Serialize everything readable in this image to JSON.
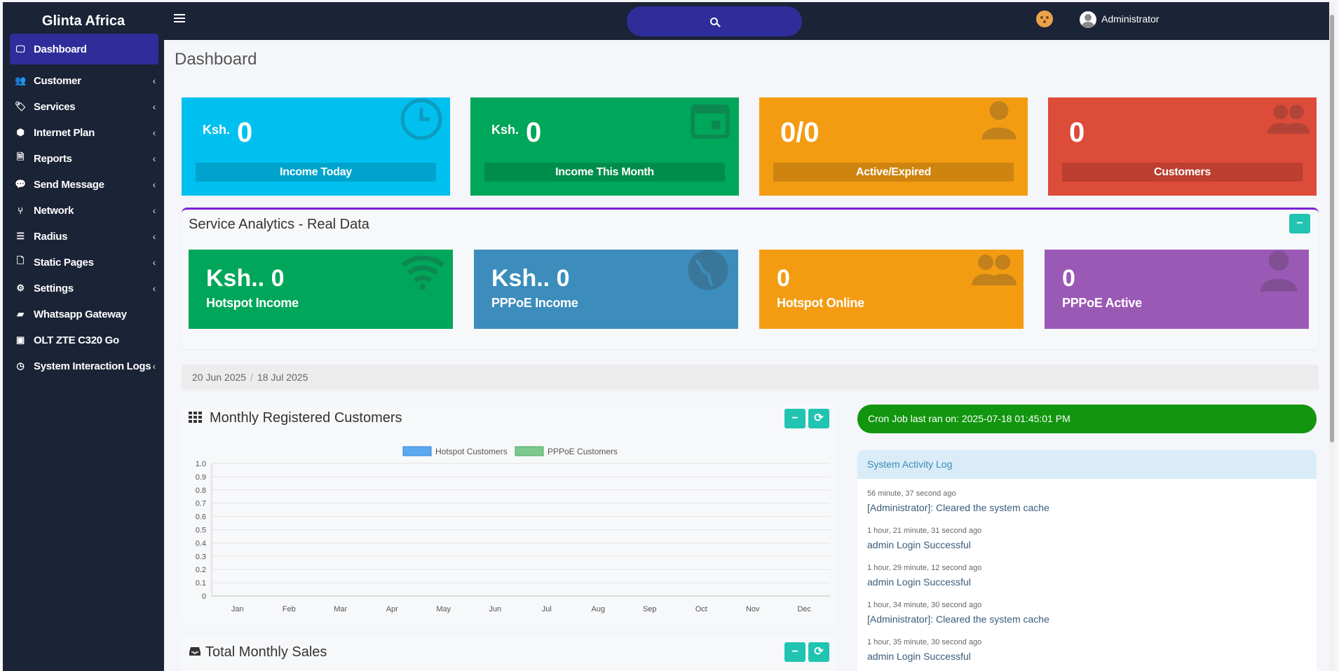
{
  "brand": "Glinta Africa",
  "user": {
    "name": "Administrator"
  },
  "sidebar": {
    "items": [
      {
        "label": "Dashboard",
        "icon": "monitor-icon",
        "glyph": "🖵",
        "chevron": false
      },
      {
        "label": "Customer",
        "icon": "users-icon",
        "glyph": "👥",
        "chevron": true
      },
      {
        "label": "Services",
        "icon": "tag-icon",
        "glyph": "🏷",
        "chevron": true
      },
      {
        "label": "Internet Plan",
        "icon": "cube-icon",
        "glyph": "⬢",
        "chevron": true
      },
      {
        "label": "Reports",
        "icon": "report-icon",
        "glyph": "🗎",
        "chevron": true
      },
      {
        "label": "Send Message",
        "icon": "chat-icon",
        "glyph": "💬",
        "chevron": true
      },
      {
        "label": "Network",
        "icon": "network-icon",
        "glyph": "⑂",
        "chevron": true
      },
      {
        "label": "Radius",
        "icon": "database-icon",
        "glyph": "☰",
        "chevron": true
      },
      {
        "label": "Static Pages",
        "icon": "file-icon",
        "glyph": "🗋",
        "chevron": true
      },
      {
        "label": "Settings",
        "icon": "gear-icon",
        "glyph": "⚙",
        "chevron": true
      },
      {
        "label": "Whatsapp Gateway",
        "icon": "comment-icon",
        "glyph": "▰",
        "chevron": false
      },
      {
        "label": "OLT ZTE C320 Go",
        "icon": "device-icon",
        "glyph": "▣",
        "chevron": false
      },
      {
        "label": "System Interaction Logs",
        "icon": "clock-icon",
        "glyph": "◷",
        "chevron": true
      }
    ]
  },
  "page_title": "Dashboard",
  "info_boxes": [
    {
      "prefix": "Ksh.",
      "value": "0",
      "label": "Income Today",
      "color": "#00c0ef",
      "icon": "clock-icon"
    },
    {
      "prefix": "Ksh.",
      "value": "0",
      "label": "Income This Month",
      "color": "#00a65a",
      "icon": "calendar-icon"
    },
    {
      "prefix": "",
      "value": "0/0",
      "label": "Active/Expired",
      "color": "#f39c12",
      "icon": "user-icon"
    },
    {
      "prefix": "",
      "value": "0",
      "label": "Customers",
      "color": "#dd4b39",
      "icon": "users-icon"
    }
  ],
  "analytics": {
    "title": "Service Analytics - Real Data",
    "collapse_label": "−",
    "stats": [
      {
        "value": "Ksh.. 0",
        "label": "Hotspot Income",
        "color": "#00a65a",
        "icon": "wifi-icon"
      },
      {
        "value": "Ksh.. 0",
        "label": "PPPoE Income",
        "color": "#3c8dbc",
        "icon": "globe-icon"
      },
      {
        "value": "0",
        "label": "Hotspot Online",
        "color": "#f39c12",
        "icon": "users-icon"
      },
      {
        "value": "0",
        "label": "PPPoE Active",
        "color": "#9b59b6",
        "icon": "user-icon"
      }
    ]
  },
  "breadcrumb": {
    "from": "20 Jun 2025",
    "to": "18 Jul 2025"
  },
  "monthly_chart": {
    "title": "Monthly Registered Customers",
    "collapse_label": "−",
    "refresh_label": "⟳"
  },
  "chart_data": {
    "type": "bar",
    "categories": [
      "Jan",
      "Feb",
      "Mar",
      "Apr",
      "May",
      "Jun",
      "Jul",
      "Aug",
      "Sep",
      "Oct",
      "Nov",
      "Dec"
    ],
    "series": [
      {
        "name": "Hotspot Customers",
        "values": [
          0,
          0,
          0,
          0,
          0,
          0,
          0,
          0,
          0,
          0,
          0,
          0
        ],
        "color": "#5aa9f0"
      },
      {
        "name": "PPPoE Customers",
        "values": [
          0,
          0,
          0,
          0,
          0,
          0,
          0,
          0,
          0,
          0,
          0,
          0
        ],
        "color": "#7dc98d"
      }
    ],
    "ylim": [
      0,
      1.0
    ],
    "yticks": [
      "1.0",
      "0.9",
      "0.8",
      "0.7",
      "0.6",
      "0.5",
      "0.4",
      "0.3",
      "0.2",
      "0.1",
      "0"
    ],
    "legend": "top",
    "grid": true
  },
  "sales_panel": {
    "title": "Total Monthly Sales",
    "collapse_label": "−",
    "refresh_label": "⟳"
  },
  "cron": {
    "text": "Cron Job last ran on: 2025-07-18 01:45:01 PM"
  },
  "activity_log": {
    "title": "System Activity Log",
    "entries": [
      {
        "time": "56 minute, 37 second ago",
        "text": "[Administrator]: Cleared the system cache"
      },
      {
        "time": "1 hour, 21 minute, 31 second ago",
        "text": "admin Login Successful"
      },
      {
        "time": "1 hour, 29 minute, 12 second ago",
        "text": "admin Login Successful"
      },
      {
        "time": "1 hour, 34 minute, 30 second ago",
        "text": "[Administrator]: Cleared the system cache"
      },
      {
        "time": "1 hour, 35 minute, 30 second ago",
        "text": "admin Login Successful"
      }
    ]
  }
}
